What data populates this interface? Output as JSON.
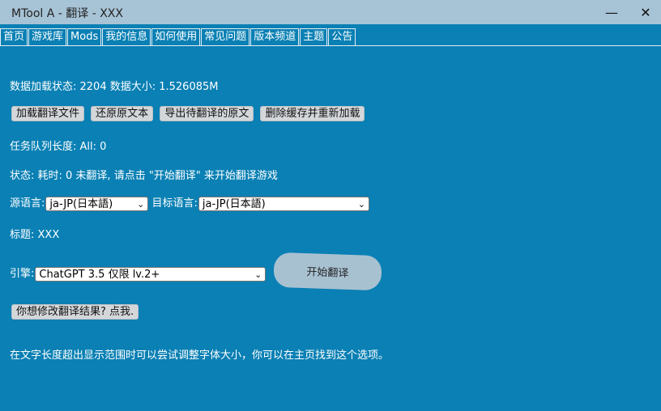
{
  "window": {
    "title": "MTool A - 翻译 - XXX",
    "minimize": "—",
    "close": "✕"
  },
  "tabs": [
    "首页",
    "游戏库",
    "Mods",
    "我的信息",
    "如何使用",
    "常见问题",
    "版本频道",
    "主题",
    "公告"
  ],
  "status": {
    "load_status": "数据加载状态: 2204 数据大小: 1.526085M",
    "queue": "任务队列长度: All: 0",
    "state": "状态: 耗时: 0 未翻译, 请点击 \"开始翻译\" 来开始翻译游戏",
    "title": "标题: XXX"
  },
  "actions": {
    "load": "加载翻译文件",
    "restore": "还原原文本",
    "export": "导出待翻译的原文",
    "clear_reload": "删除缓存并重新加载"
  },
  "language": {
    "source_label": "源语言:",
    "source_value": "ja-JP(日本語)",
    "target_label": "目标语言:",
    "target_value": "ja-JP(日本語)"
  },
  "engine": {
    "label": "引擎:",
    "value": "ChatGPT 3.5 仅限 lv.2+"
  },
  "start_button": "开始翻译",
  "modify_button": "你想修改翻译结果? 点我.",
  "hint": "在文字长度超出显示范围时可以尝试调整字体大小，你可以在主页找到这个选项。",
  "colors": {
    "background": "#0a80b4",
    "titlebar": "#a7c3d6"
  }
}
